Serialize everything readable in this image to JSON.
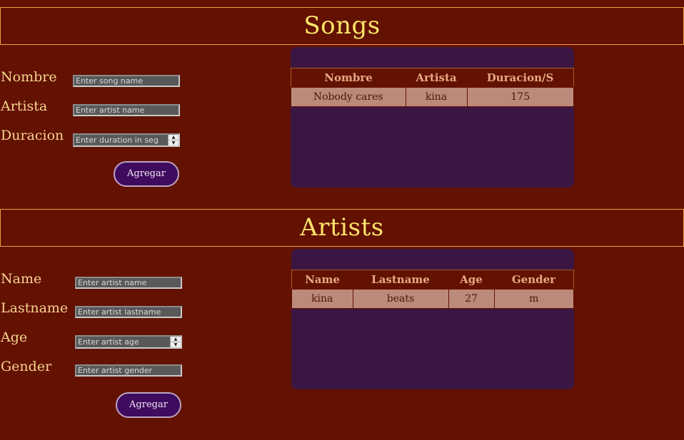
{
  "songs": {
    "title": "Songs",
    "labels": {
      "nombre": "Nombre",
      "artista": "Artista",
      "duracion": "Duracion"
    },
    "placeholders": {
      "nombre": "Enter song name",
      "artista": "Enter artist name",
      "duracion": "Enter duration in seg"
    },
    "button": "Agregar",
    "table": {
      "headers": [
        "Nombre",
        "Artista",
        "Duracion/S"
      ],
      "rows": [
        [
          "Nobody cares",
          "kina",
          "175"
        ]
      ]
    }
  },
  "artists": {
    "title": "Artists",
    "labels": {
      "name": "Name",
      "lastname": "Lastname",
      "age": "Age",
      "gender": "Gender"
    },
    "placeholders": {
      "name": "Enter artist name",
      "lastname": "Enter artist lastname",
      "age": "Enter artist age",
      "gender": "Enter artist gender"
    },
    "button": "Agregar",
    "table": {
      "headers": [
        "Name",
        "Lastname",
        "Age",
        "Gender"
      ],
      "rows": [
        [
          "kina",
          "beats",
          "27",
          "m"
        ]
      ]
    }
  },
  "colors": {
    "background": "#631100",
    "accent": "#fde46a",
    "panel": "#3c1642",
    "cell": "#bc8a7a",
    "button": "#3e0b5e"
  }
}
